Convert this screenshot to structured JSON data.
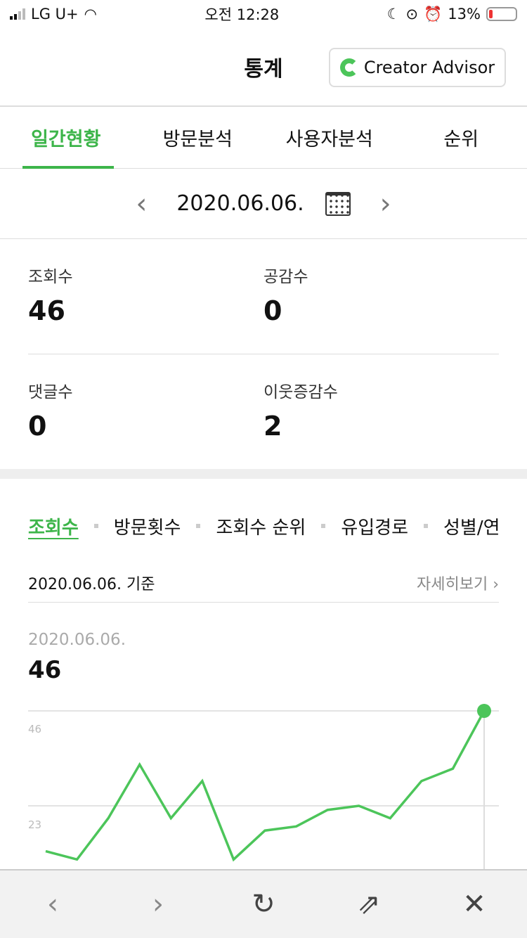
{
  "status": {
    "carrier": "LG U+",
    "time": "오전 12:28",
    "battery": "13%",
    "battery_level": 13
  },
  "header": {
    "title": "통계",
    "badge": "Creator Advisor"
  },
  "tabs": [
    {
      "label": "일간현황",
      "active": true
    },
    {
      "label": "방문분석"
    },
    {
      "label": "사용자분석"
    },
    {
      "label": "순위"
    }
  ],
  "date": "2020.06.06.",
  "stats": [
    {
      "label": "조회수",
      "value": "46"
    },
    {
      "label": "공감수",
      "value": "0"
    },
    {
      "label": "댓글수",
      "value": "0"
    },
    {
      "label": "이웃증감수",
      "value": "2"
    }
  ],
  "subtabs": [
    "조회수",
    "방문횟수",
    "조회수 순위",
    "유입경로",
    "성별/연"
  ],
  "basis": {
    "text": "2020.06.06. 기준",
    "more": "자세히보기 ›"
  },
  "selected": {
    "date": "2020.06.06.",
    "value": "46"
  },
  "chart_data": {
    "type": "line",
    "color": "#4cc55a",
    "yticks": [
      "46",
      "23"
    ],
    "ylim": [
      0,
      46
    ],
    "values": [
      12,
      10,
      20,
      33,
      20,
      29,
      10,
      17,
      18,
      22,
      23,
      20,
      29,
      32,
      46
    ],
    "highlight_last": true
  },
  "toolbar": {
    "icons": [
      "back-icon",
      "forward-icon",
      "reload-icon",
      "share-icon",
      "close-icon"
    ]
  }
}
